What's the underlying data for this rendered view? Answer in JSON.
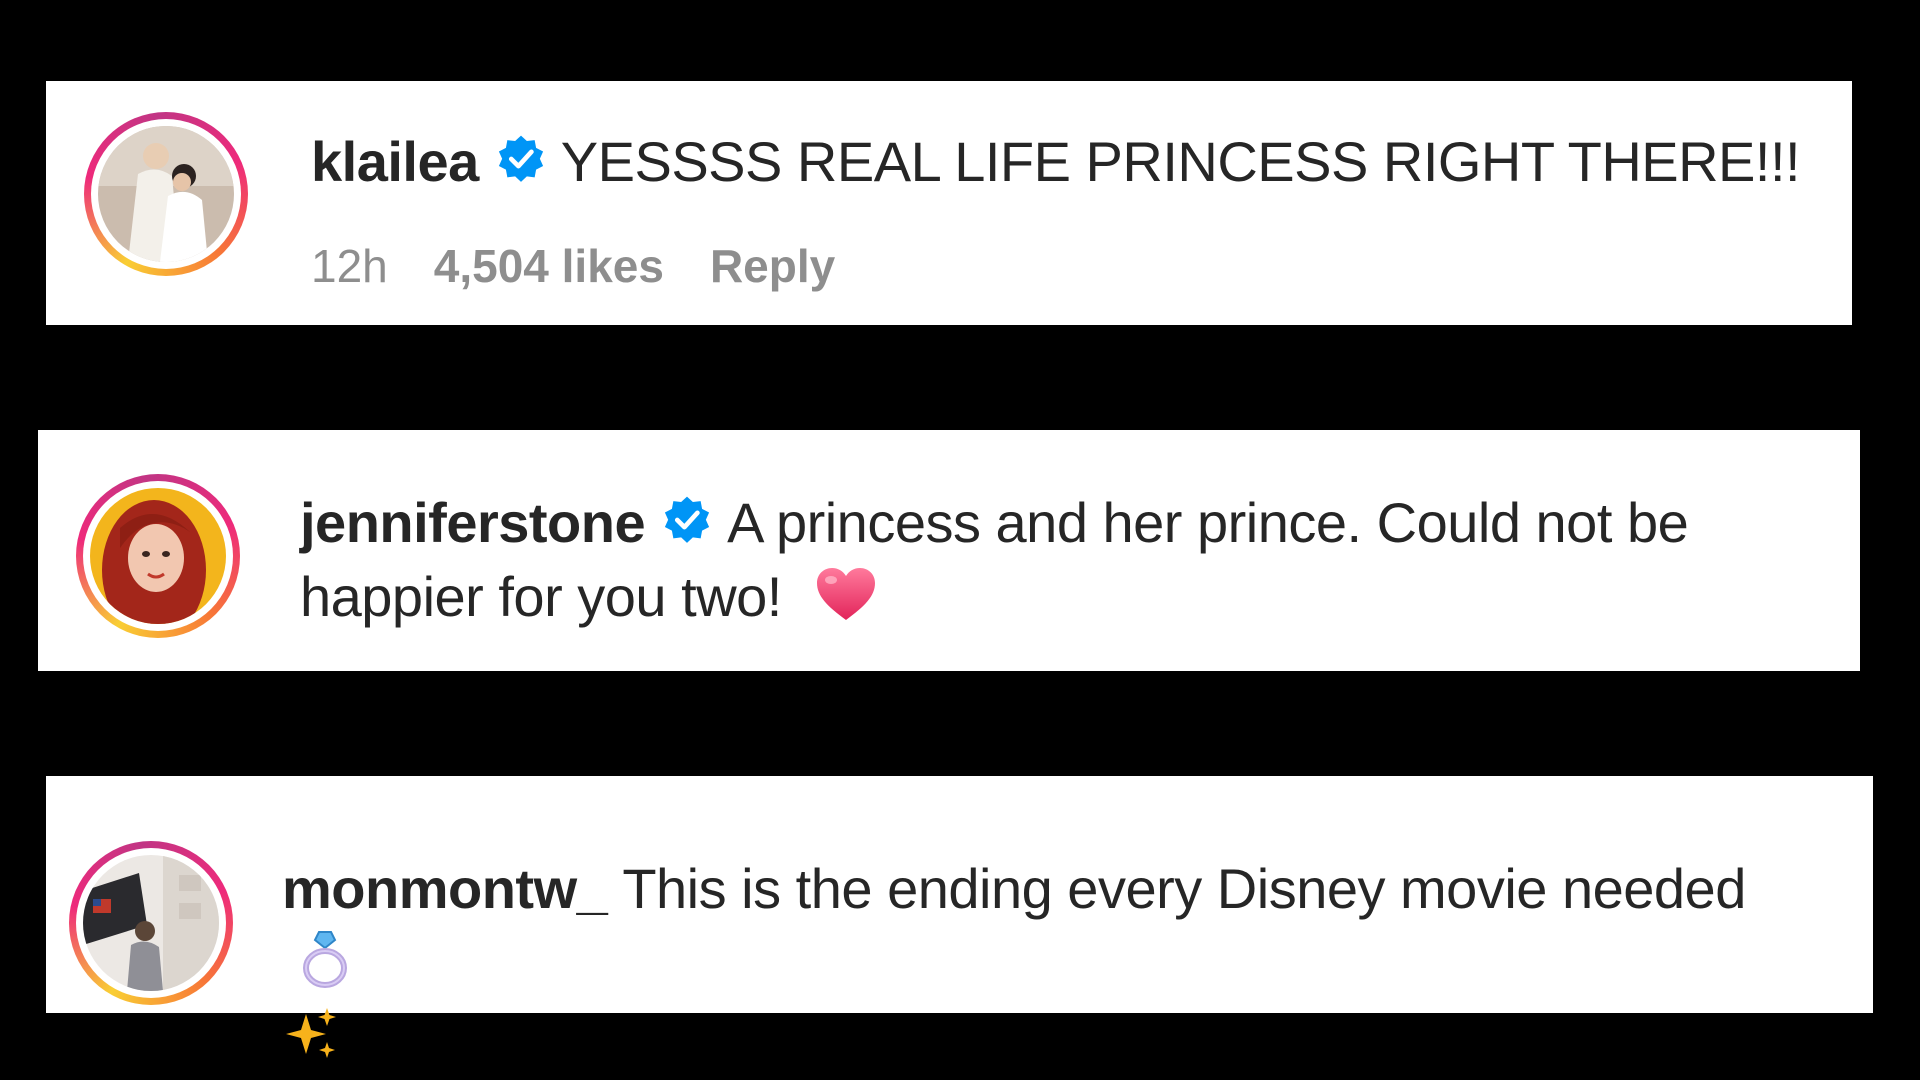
{
  "comments": [
    {
      "username": "klailea",
      "verified": true,
      "text": "YESSSS REAL LIFE PRINCESS RIGHT THERE!!!",
      "time": "12h",
      "likes": "4,504 likes",
      "reply": "Reply",
      "avatar_icon": "couple-photo"
    },
    {
      "username": "jenniferstone",
      "verified": true,
      "text": "A princess and her prince. Could not be happier for you two!",
      "emoji": "heart-emoji",
      "avatar_icon": "red-hair-portrait"
    },
    {
      "username": "monmontw_",
      "verified": false,
      "text": "This is the ending every Disney movie needed",
      "emoji": [
        "ring-emoji",
        "sparkles-emoji"
      ],
      "avatar_icon": "room-photo"
    }
  ],
  "colors": {
    "background": "#000000",
    "card": "#ffffff",
    "text": "#262626",
    "meta": "#8e8e8e",
    "verified": "#0095f6",
    "heart": "#f0466e"
  }
}
